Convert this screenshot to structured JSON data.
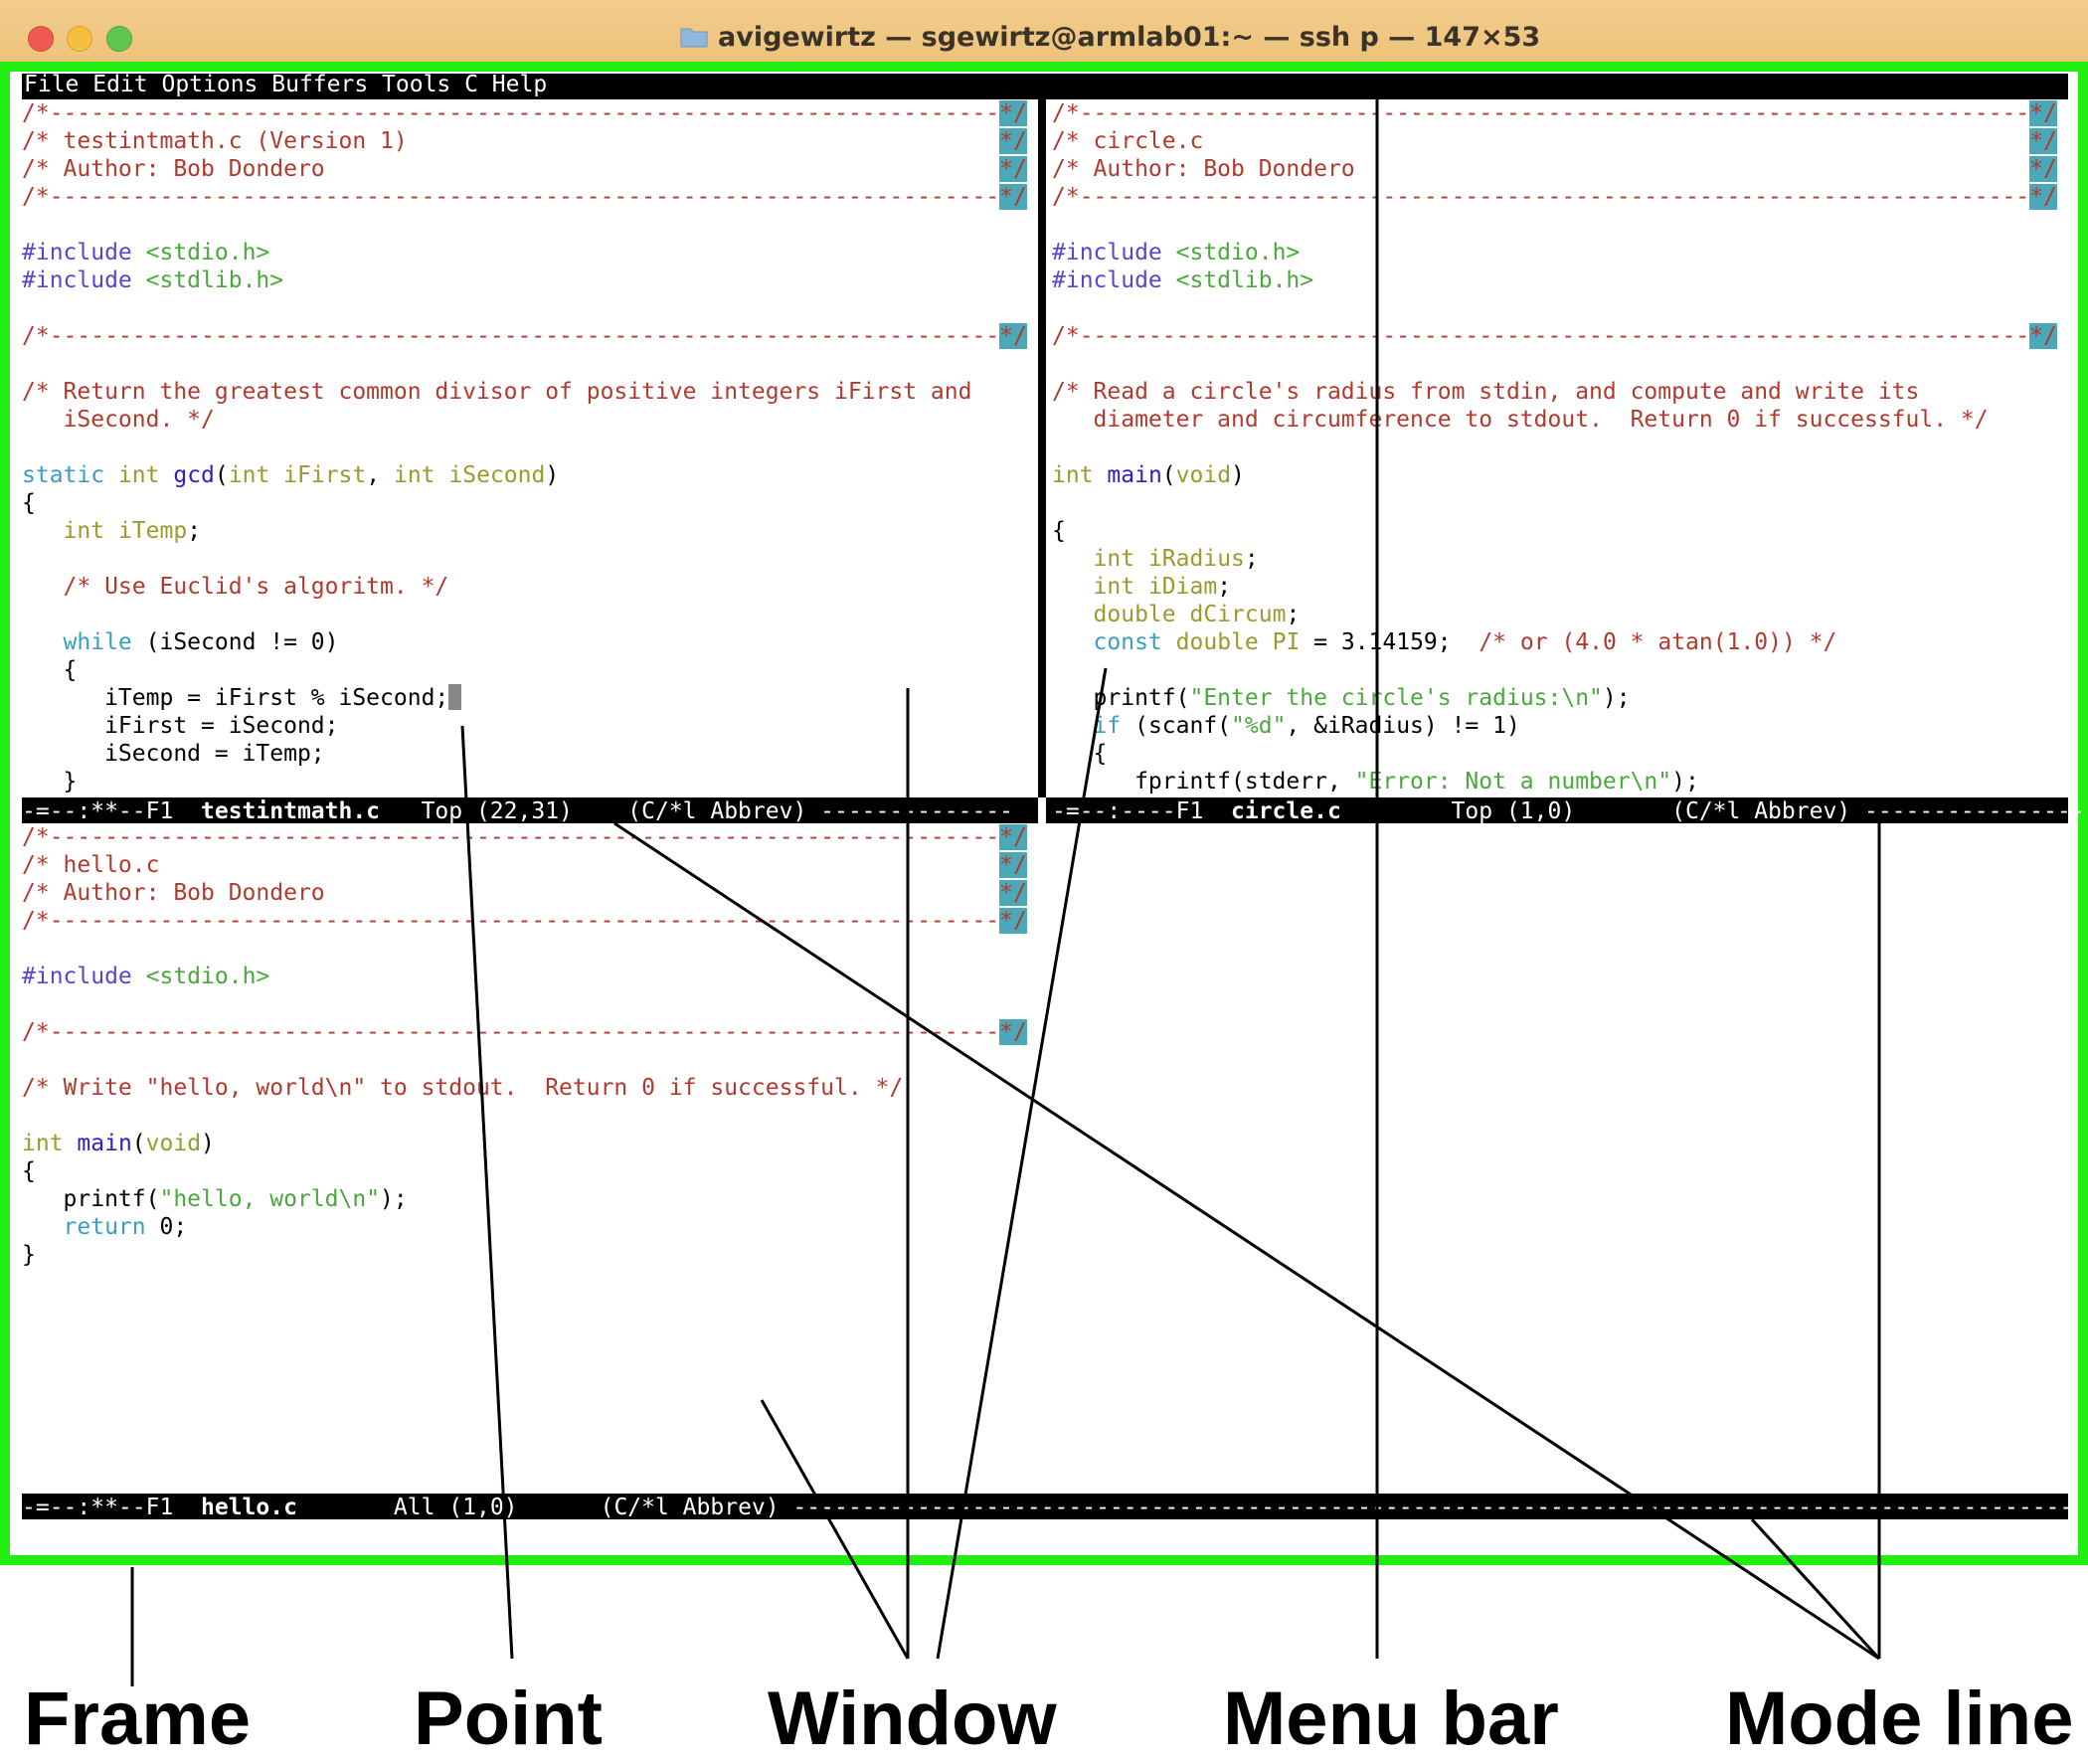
{
  "window": {
    "title": "avigewirtz — sgewirtz@armlab01:~ — ssh p — 147×53",
    "frame_color": "#22ee11"
  },
  "menubar": {
    "text": "File Edit Options Buffers Tools C Help"
  },
  "windows": {
    "top_left": {
      "lines": [
        "/*---------------------------------------------------------------------*/",
        "/* testintmath.c (Version 1)                                           */",
        "/* Author: Bob Dondero                                                 */",
        "/*---------------------------------------------------------------------*/",
        "",
        "#include <stdio.h>",
        "#include <stdlib.h>",
        "",
        "/*---------------------------------------------------------------------*/",
        "",
        "/* Return the greatest common divisor of positive integers iFirst and",
        "   iSecond. */",
        "",
        "static int gcd(int iFirst, int iSecond)",
        "{",
        "   int iTemp;",
        "",
        "   /* Use Euclid's algoritm. */",
        "",
        "   while (iSecond != 0)",
        "   {",
        "      iTemp = iFirst % iSecond;",
        "      iFirst = iSecond;",
        "      iSecond = iTemp;",
        "   }"
      ],
      "modeline": {
        "prefix": "-=--:**--F1  ",
        "buffer": "testintmath.c",
        "info": "   Top (22,31)    (C/*l Abbrev) --------------"
      }
    },
    "top_right": {
      "lines": [
        "/*---------------------------------------------------------------------*/",
        "/* circle.c                                                            */",
        "/* Author: Bob Dondero                                                 */",
        "/*---------------------------------------------------------------------*/",
        "",
        "#include <stdio.h>",
        "#include <stdlib.h>",
        "",
        "/*---------------------------------------------------------------------*/",
        "",
        "/* Read a circle's radius from stdin, and compute and write its",
        "   diameter and circumference to stdout.  Return 0 if successful. */",
        "",
        "int main(void)",
        "",
        "{",
        "   int iRadius;",
        "   int iDiam;",
        "   double dCircum;",
        "   const double PI = 3.14159;  /* or (4.0 * atan(1.0)) */",
        "",
        "   printf(\"Enter the circle's radius:\\n\");",
        "   if (scanf(\"%d\", &iRadius) != 1)",
        "   {",
        "      fprintf(stderr, \"Error: Not a number\\n\");"
      ],
      "modeline": {
        "prefix": "-=--:----F1  ",
        "buffer": "circle.c",
        "info": "        Top (1,0)       (C/*l Abbrev) ----------------"
      }
    },
    "bottom": {
      "lines": [
        "/*---------------------------------------------------------------------*/",
        "/* hello.c                                                             */",
        "/* Author: Bob Dondero                                                 */",
        "/*---------------------------------------------------------------------*/",
        "",
        "#include <stdio.h>",
        "",
        "/*---------------------------------------------------------------------*/",
        "",
        "/* Write \"hello, world\\n\" to stdout.  Return 0 if successful. */",
        "",
        "int main(void)",
        "{",
        "   printf(\"hello, world\\n\");",
        "   return 0;",
        "}"
      ],
      "modeline": {
        "prefix": "-=--:**--F1  ",
        "buffer": "hello.c",
        "info": "       All (1,0)      (C/*l Abbrev) ------------------------------------------------------------------------------------------------------------------------"
      }
    }
  },
  "annotations": {
    "frame": "Frame",
    "point": "Point",
    "window": "Window",
    "menu_bar": "Menu bar",
    "mode_line": "Mode line"
  }
}
